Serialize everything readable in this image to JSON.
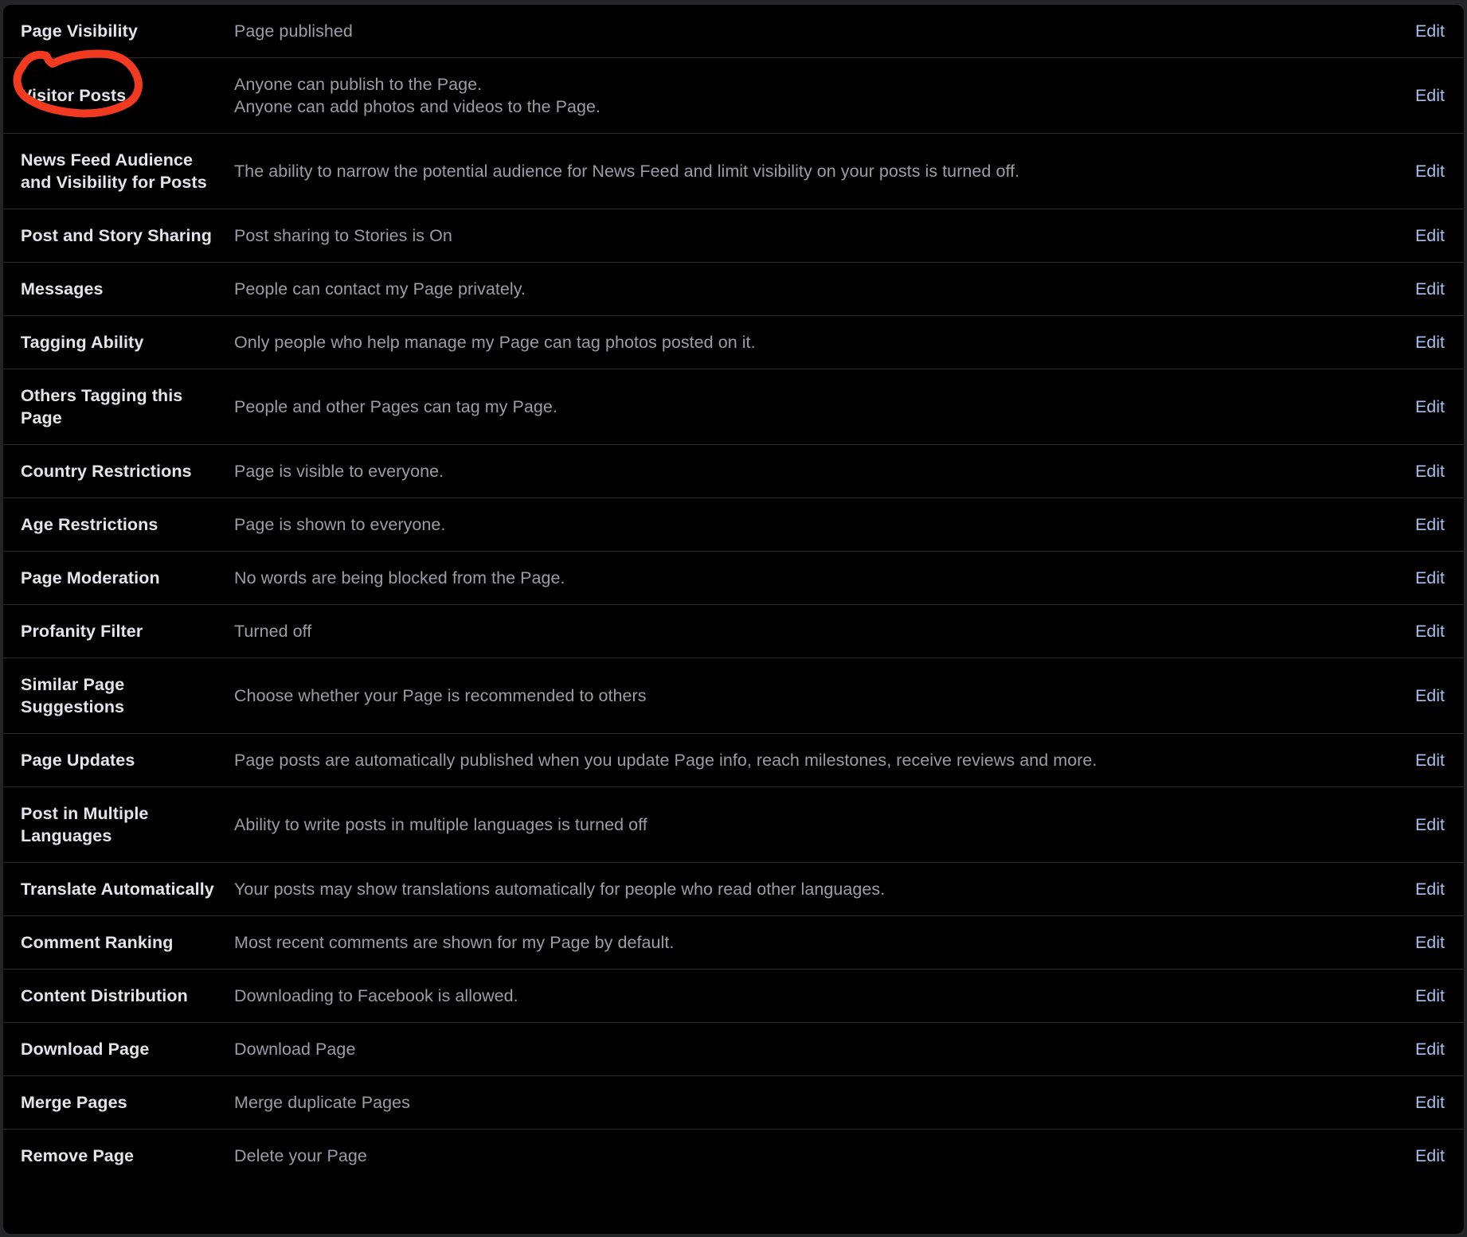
{
  "panel": {
    "name": "page-settings-general-list",
    "accent_edit_color": "#a7c0ed",
    "label_color": "#e4e6eb",
    "description_color": "#9a9ea3",
    "background_color": "#000000",
    "divider_color": "#2a2b2c",
    "annotation_color": "#f23a21"
  },
  "annotation": {
    "type": "hand-drawn-ellipse",
    "target_label": "Visitor Posts",
    "color": "#f23a21"
  },
  "action_label": "Edit",
  "rows": [
    {
      "label": "Page Visibility",
      "description": [
        "Page published"
      ],
      "action": "Edit"
    },
    {
      "label": "Visitor Posts",
      "description": [
        "Anyone can publish to the Page.",
        "Anyone can add photos and videos to the Page."
      ],
      "action": "Edit",
      "annotated": true
    },
    {
      "label": "News Feed Audience and Visibility for Posts",
      "description": [
        "The ability to narrow the potential audience for News Feed and limit visibility on your posts is turned off."
      ],
      "action": "Edit"
    },
    {
      "label": "Post and Story Sharing",
      "description": [
        "Post sharing to Stories is On"
      ],
      "action": "Edit"
    },
    {
      "label": "Messages",
      "description": [
        "People can contact my Page privately."
      ],
      "action": "Edit"
    },
    {
      "label": "Tagging Ability",
      "description": [
        "Only people who help manage my Page can tag photos posted on it."
      ],
      "action": "Edit"
    },
    {
      "label": "Others Tagging this Page",
      "description": [
        "People and other Pages can tag my Page."
      ],
      "action": "Edit"
    },
    {
      "label": "Country Restrictions",
      "description": [
        "Page is visible to everyone."
      ],
      "action": "Edit"
    },
    {
      "label": "Age Restrictions",
      "description": [
        "Page is shown to everyone."
      ],
      "action": "Edit"
    },
    {
      "label": "Page Moderation",
      "description": [
        "No words are being blocked from the Page."
      ],
      "action": "Edit"
    },
    {
      "label": "Profanity Filter",
      "description": [
        "Turned off"
      ],
      "action": "Edit"
    },
    {
      "label": "Similar Page Suggestions",
      "description": [
        "Choose whether your Page is recommended to others"
      ],
      "action": "Edit"
    },
    {
      "label": "Page Updates",
      "description": [
        "Page posts are automatically published when you update Page info, reach milestones, receive reviews and more."
      ],
      "action": "Edit"
    },
    {
      "label": "Post in Multiple Languages",
      "description": [
        "Ability to write posts in multiple languages is turned off"
      ],
      "action": "Edit"
    },
    {
      "label": "Translate Automatically",
      "description": [
        "Your posts may show translations automatically for people who read other languages."
      ],
      "action": "Edit"
    },
    {
      "label": "Comment Ranking",
      "description": [
        "Most recent comments are shown for my Page by default."
      ],
      "action": "Edit"
    },
    {
      "label": "Content Distribution",
      "description": [
        "Downloading to Facebook is allowed."
      ],
      "action": "Edit"
    },
    {
      "label": "Download Page",
      "description": [
        "Download Page"
      ],
      "action": "Edit"
    },
    {
      "label": "Merge Pages",
      "description": [
        "Merge duplicate Pages"
      ],
      "action": "Edit"
    },
    {
      "label": "Remove Page",
      "description": [
        "Delete your Page"
      ],
      "action": "Edit"
    }
  ]
}
